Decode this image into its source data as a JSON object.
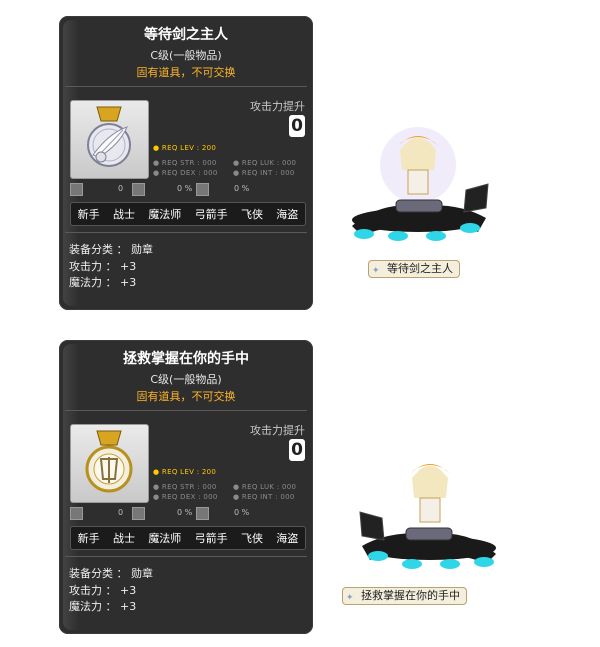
{
  "items": [
    {
      "title": "等待剑之主人",
      "grade": "C级(一般物品)",
      "trade": "固有道具，不可交换",
      "attack_boost_label": "攻击力提升",
      "attack_boost_value": "0",
      "req_lev": "● REQ LEV : 200",
      "req_str": "● REQ STR : 000",
      "req_luk": "● REQ LUK : 000",
      "req_dex": "● REQ DEX : 000",
      "req_int": "● REQ INT : 000",
      "stat_values": [
        "0",
        "0 %",
        "0 %"
      ],
      "jobs": [
        "新手",
        "战士",
        "魔法师",
        "弓箭手",
        "飞侠",
        "海盗"
      ],
      "category": "装备分类 ： 勋章",
      "attack": "攻击力 ： +3",
      "magic": "魔法力 ： +3",
      "icon": "feather-medal-icon",
      "name_tag": "等待剑之主人"
    },
    {
      "title": "拯救掌握在你的手中",
      "grade": "C级(一般物品)",
      "trade": "固有道具，不可交换",
      "attack_boost_label": "攻击力提升",
      "attack_boost_value": "0",
      "req_lev": "● REQ LEV : 200",
      "req_str": "● REQ STR : 000",
      "req_luk": "● REQ LUK : 000",
      "req_dex": "● REQ DEX : 000",
      "req_int": "● REQ INT : 000",
      "stat_values": [
        "0",
        "0 %",
        "0 %"
      ],
      "jobs": [
        "新手",
        "战士",
        "魔法师",
        "弓箭手",
        "飞侠",
        "海盗"
      ],
      "category": "装备分类 ： 勋章",
      "attack": "攻击力 ： +3",
      "magic": "魔法力 ： +3",
      "icon": "gold-shield-medal-icon",
      "name_tag": "拯救掌握在你的手中"
    }
  ],
  "colors": {
    "card_bg": "#2e2e2e",
    "trade_text": "#ffb428",
    "req_lev": "#ffc800",
    "panther": "#1a1a1a",
    "glow": "#2fd6e8"
  }
}
